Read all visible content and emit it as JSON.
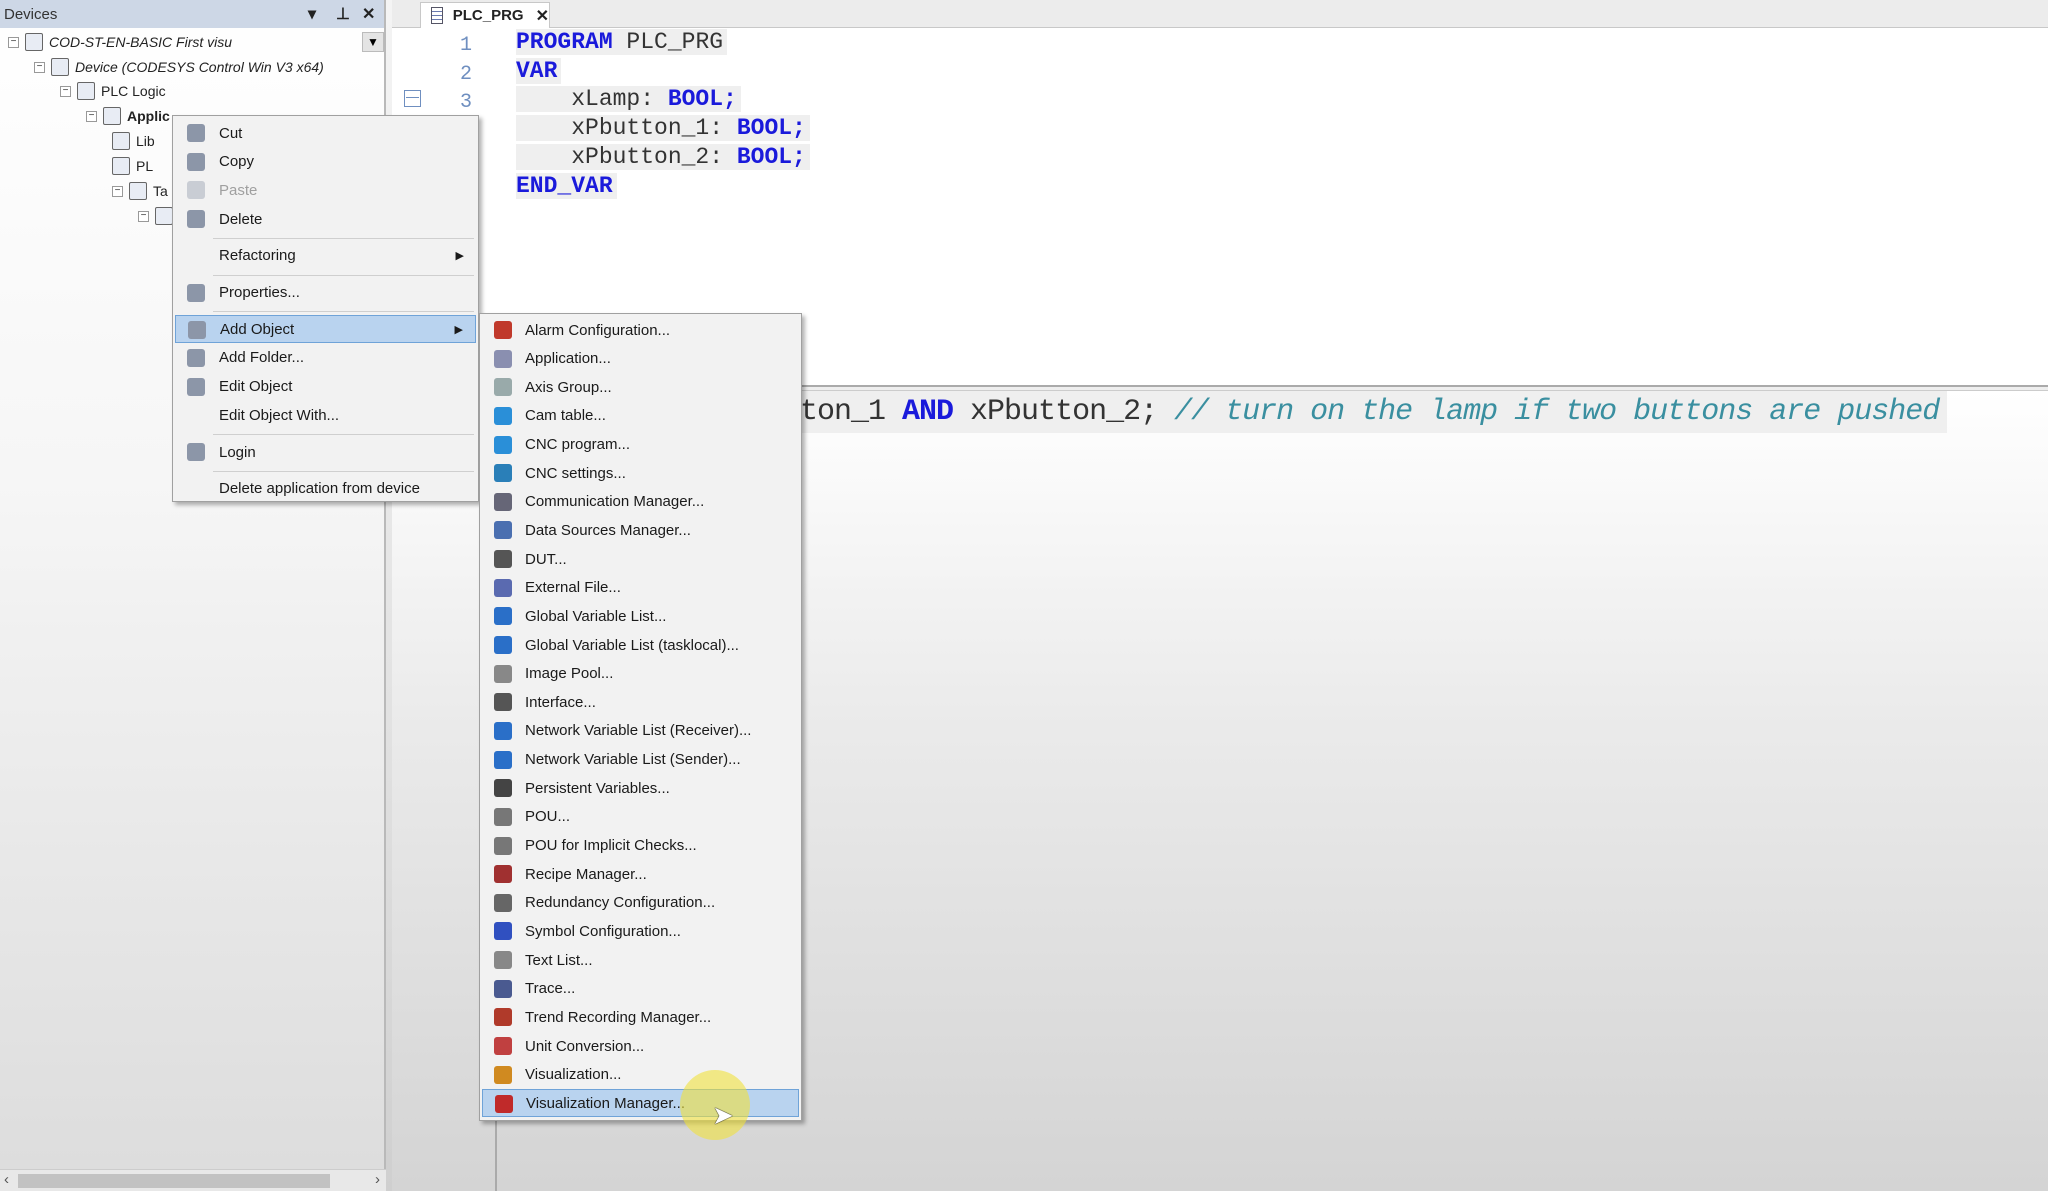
{
  "devices_panel": {
    "title": "Devices",
    "tree": [
      {
        "label": "COD-ST-EN-BASIC First visu",
        "italic": true,
        "level": 0
      },
      {
        "label": "Device (CODESYS Control Win V3 x64)",
        "italic": true,
        "level": 1
      },
      {
        "label": "PLC Logic",
        "level": 2
      },
      {
        "label": "Applic",
        "bold": true,
        "level": 3
      },
      {
        "label": "Lib",
        "level": 4
      },
      {
        "label": "PL",
        "level": 4
      },
      {
        "label": "Ta",
        "level": 4
      },
      {
        "label": "",
        "level": 5
      }
    ]
  },
  "editor": {
    "tab": "PLC_PRG",
    "line_numbers": [
      "1",
      "2",
      "3"
    ],
    "declaration": [
      [
        {
          "t": "PROGRAM",
          "k": 1
        },
        {
          "t": " PLC_PRG"
        }
      ],
      [
        {
          "t": "VAR",
          "k": 1
        }
      ],
      [
        {
          "t": "    xLamp: "
        },
        {
          "t": "BOOL;",
          "k": 1
        }
      ],
      [
        {
          "t": "    xPbutton_1: "
        },
        {
          "t": "BOOL;",
          "k": 1
        }
      ],
      [
        {
          "t": "    xPbutton_2: "
        },
        {
          "t": "BOOL;",
          "k": 1
        }
      ],
      [
        {
          "t": "END_VAR",
          "k": 1
        }
      ]
    ],
    "body_line": {
      "pre": "ton_1 ",
      "kw": "AND",
      "post": " xPbutton_2;",
      "comment": " // turn on the lamp if two buttons are pushed"
    }
  },
  "context_menu": {
    "items": [
      {
        "label": "Cut",
        "icon": "scissors-icon"
      },
      {
        "label": "Copy",
        "icon": "copy-icon"
      },
      {
        "label": "Paste",
        "icon": "paste-icon",
        "disabled": true
      },
      {
        "label": "Delete",
        "icon": "delete-x-icon",
        "sep_after": true
      },
      {
        "label": "Refactoring",
        "submenu": true,
        "sep_after": true
      },
      {
        "label": "Properties...",
        "icon": "properties-icon",
        "sep_after": true
      },
      {
        "label": "Add Object",
        "icon": "add-object-icon",
        "submenu": true,
        "highlighted": true
      },
      {
        "label": "Add Folder...",
        "icon": "folder-icon"
      },
      {
        "label": "Edit Object",
        "icon": "edit-object-icon"
      },
      {
        "label": "Edit Object With...",
        "sep_after": true
      },
      {
        "label": "Login",
        "icon": "login-icon",
        "sep_after": true
      },
      {
        "label": "Delete application from device"
      }
    ]
  },
  "add_object_menu": {
    "items": [
      {
        "label": "Alarm Configuration...",
        "color": "#c0392b"
      },
      {
        "label": "Application...",
        "color": "#8a8fb0"
      },
      {
        "label": "Axis Group...",
        "color": "#9aa"
      },
      {
        "label": "Cam table...",
        "color": "#2a8fd8"
      },
      {
        "label": "CNC program...",
        "color": "#2a8fd8"
      },
      {
        "label": "CNC settings...",
        "color": "#2a7fb8"
      },
      {
        "label": "Communication Manager...",
        "color": "#667"
      },
      {
        "label": "Data Sources Manager...",
        "color": "#4a6fb0"
      },
      {
        "label": "DUT...",
        "color": "#555"
      },
      {
        "label": "External File...",
        "color": "#5a6ab0"
      },
      {
        "label": "Global Variable List...",
        "color": "#2a6fc8"
      },
      {
        "label": "Global Variable List (tasklocal)...",
        "color": "#2a6fc8"
      },
      {
        "label": "Image Pool...",
        "color": "#888"
      },
      {
        "label": "Interface...",
        "color": "#555"
      },
      {
        "label": "Network Variable List (Receiver)...",
        "color": "#2a6fc8"
      },
      {
        "label": "Network Variable List (Sender)...",
        "color": "#2a6fc8"
      },
      {
        "label": "Persistent Variables...",
        "color": "#444"
      },
      {
        "label": "POU...",
        "color": "#777"
      },
      {
        "label": "POU for Implicit Checks...",
        "color": "#777"
      },
      {
        "label": "Recipe Manager...",
        "color": "#a03030"
      },
      {
        "label": "Redundancy Configuration...",
        "color": "#666"
      },
      {
        "label": "Symbol Configuration...",
        "color": "#3050c0"
      },
      {
        "label": "Text List...",
        "color": "#888"
      },
      {
        "label": "Trace...",
        "color": "#4a5a90"
      },
      {
        "label": "Trend Recording Manager...",
        "color": "#b03a2a"
      },
      {
        "label": "Unit Conversion...",
        "color": "#c04040"
      },
      {
        "label": "Visualization...",
        "color": "#d08a20"
      },
      {
        "label": "Visualization Manager...",
        "color": "#c02a2a",
        "highlighted": true
      }
    ]
  },
  "colors": {
    "keyword": "#1a1adb",
    "comment": "#3a8fa0",
    "menu_highlight": "#b9d3ef"
  }
}
